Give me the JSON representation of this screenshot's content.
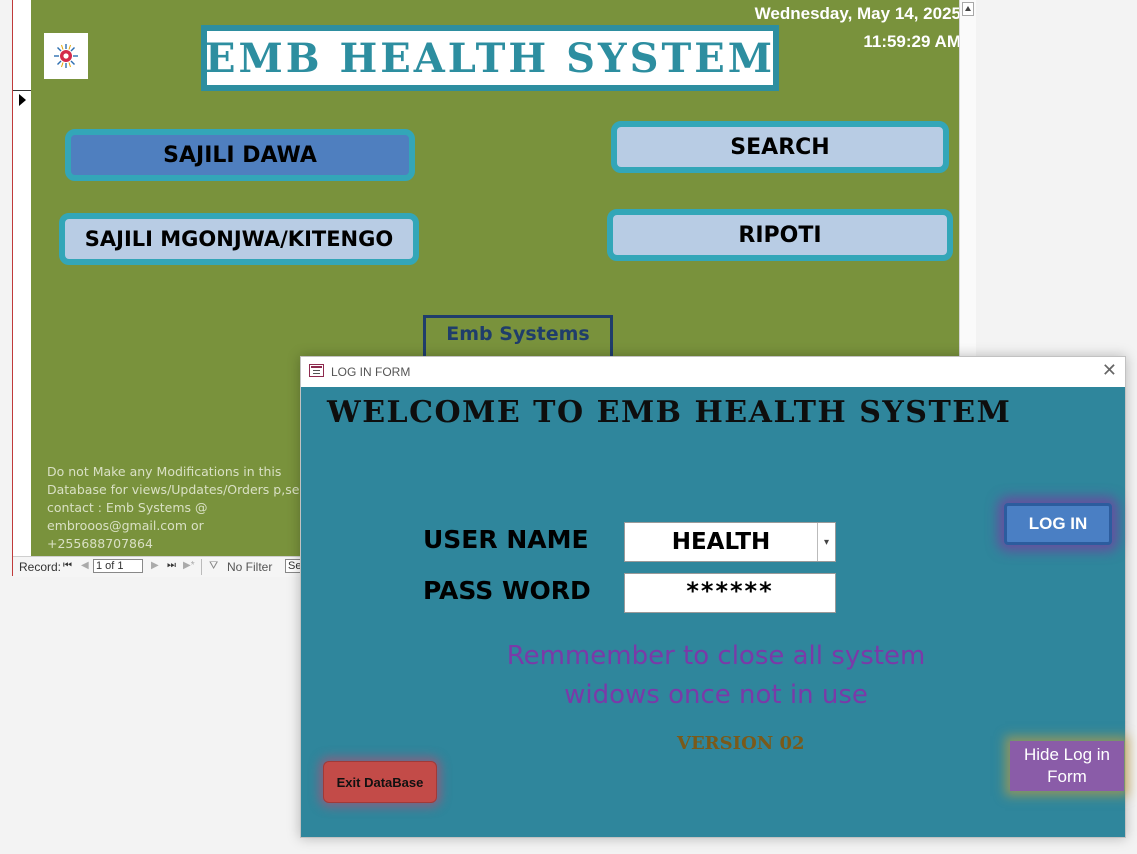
{
  "main_form": {
    "title": "EMB HEALTH SYSTEM",
    "date": "Wednesday, May 14, 2025",
    "time": "11:59:29 AM",
    "buttons": {
      "sajili_dawa": "SAJILI DAWA",
      "sajili_mgonjwa": "SAJILI MGONJWA/KITENGO",
      "search": "SEARCH",
      "ripoti": "RIPOTI"
    },
    "emb_systems_label": "Emb Systems",
    "notice_lines": [
      "Do not Make any Modifications in this",
      "Database for views/Updates/Orders p,se",
      "contact :     Emb Systems @",
      "embrooos@gmail.com      or",
      "+255688707864"
    ],
    "colors": {
      "background": "#79923c",
      "accent": "#33a6b8"
    }
  },
  "nav_bar": {
    "record_label": "Record:",
    "record_position": "1 of 1",
    "filter_label": "No Filter",
    "search_label": "Search"
  },
  "login_dialog": {
    "window_title": "LOG IN FORM",
    "heading": "WELCOME TO EMB HEALTH SYSTEM",
    "username_label": "USER NAME",
    "username_value": "HEALTH",
    "password_label": "PASS WORD",
    "password_value": "******",
    "reminder_line1": "Remmember to close all system",
    "reminder_line2": "widows once not in use",
    "version": "VERSION 02",
    "login_button": "LOG IN",
    "hide_button": "Hide Log in Form",
    "exit_button": "Exit DataBase",
    "colors": {
      "background": "#2f869c",
      "reminder": "#7a3aa8"
    }
  }
}
